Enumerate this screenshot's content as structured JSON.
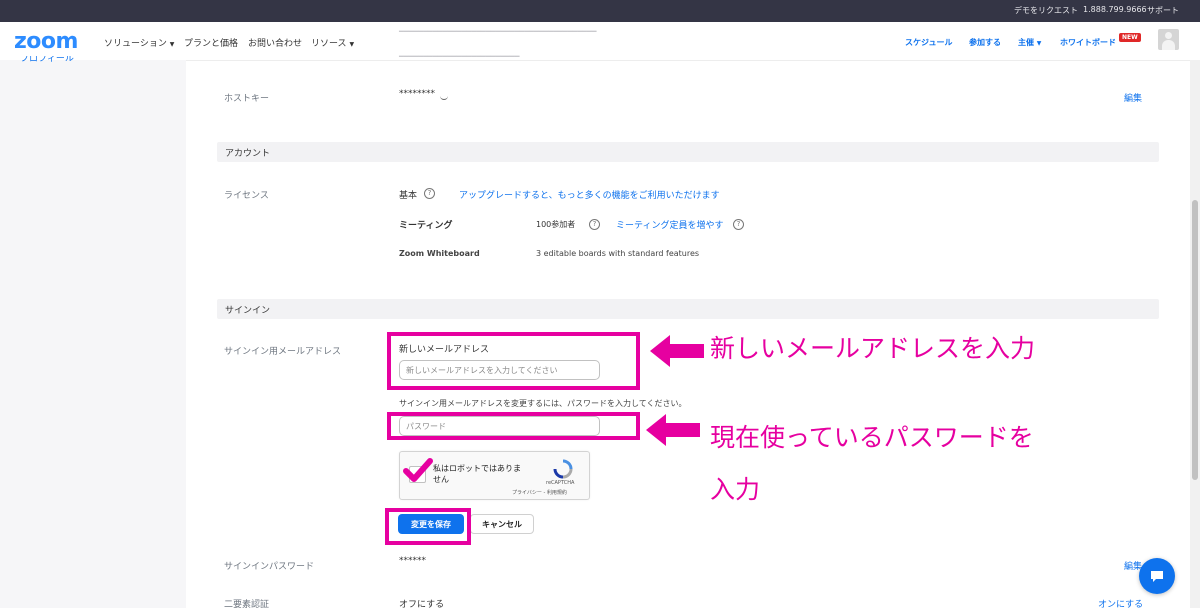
{
  "topbar": {
    "demo_request": "デモをリクエスト",
    "phone": "1.888.799.9666",
    "support": "サポート"
  },
  "navbar": {
    "logo": "zoom",
    "solutions": "ソリューション",
    "plans": "プランと価格",
    "contact": "お問い合わせ",
    "resources": "リソース",
    "schedule": "スケジュール",
    "join": "参加する",
    "host": "主催",
    "whiteboard": "ホワイトボード",
    "new_badge": "NEW"
  },
  "host_key": {
    "label": "ホストキー",
    "value": "********",
    "edit": "編集"
  },
  "account_section": {
    "title": "アカウント",
    "license_label": "ライセンス",
    "basic": "基本",
    "upgrade_link": "アップグレードすると、もっと多くの機能をご利用いただけます",
    "meeting_label": "ミーティング",
    "meeting_value": "100参加者",
    "meeting_link": "ミーティング定員を増やす",
    "whiteboard_label": "Zoom Whiteboard",
    "whiteboard_value": "3 editable boards with standard features"
  },
  "signin_section": {
    "title": "サインイン",
    "email_label": "サインイン用メールアドレス",
    "new_email_heading": "新しいメールアドレス",
    "new_email_placeholder": "新しいメールアドレスを入力してください",
    "password_instruction": "サインイン用メールアドレスを変更するには、パスワードを入力してください。",
    "password_placeholder": "パスワード",
    "save_button": "変更を保存",
    "cancel_button": "キャンセル",
    "signin_password_label": "サインインパスワード",
    "signin_password_value": "******",
    "signin_password_edit": "編集",
    "two_factor_label": "二要素認証",
    "two_factor_value": "オフにする",
    "two_factor_action": "オンにする"
  },
  "recaptcha": {
    "checkbox_label": "私はロボットではありません",
    "brand": "reCAPTCHA",
    "privacy": "プライバシー",
    "separator": " - ",
    "terms": "利用規約"
  },
  "annotations": {
    "email_note": "新しいメールアドレスを入力",
    "password_note_line1": "現在使っているパスワードを",
    "password_note_line2": "入力",
    "color": "#e600a0"
  },
  "colors": {
    "accent": "#0e72ed",
    "topbar": "#343545",
    "highlight": "#e600a0"
  }
}
